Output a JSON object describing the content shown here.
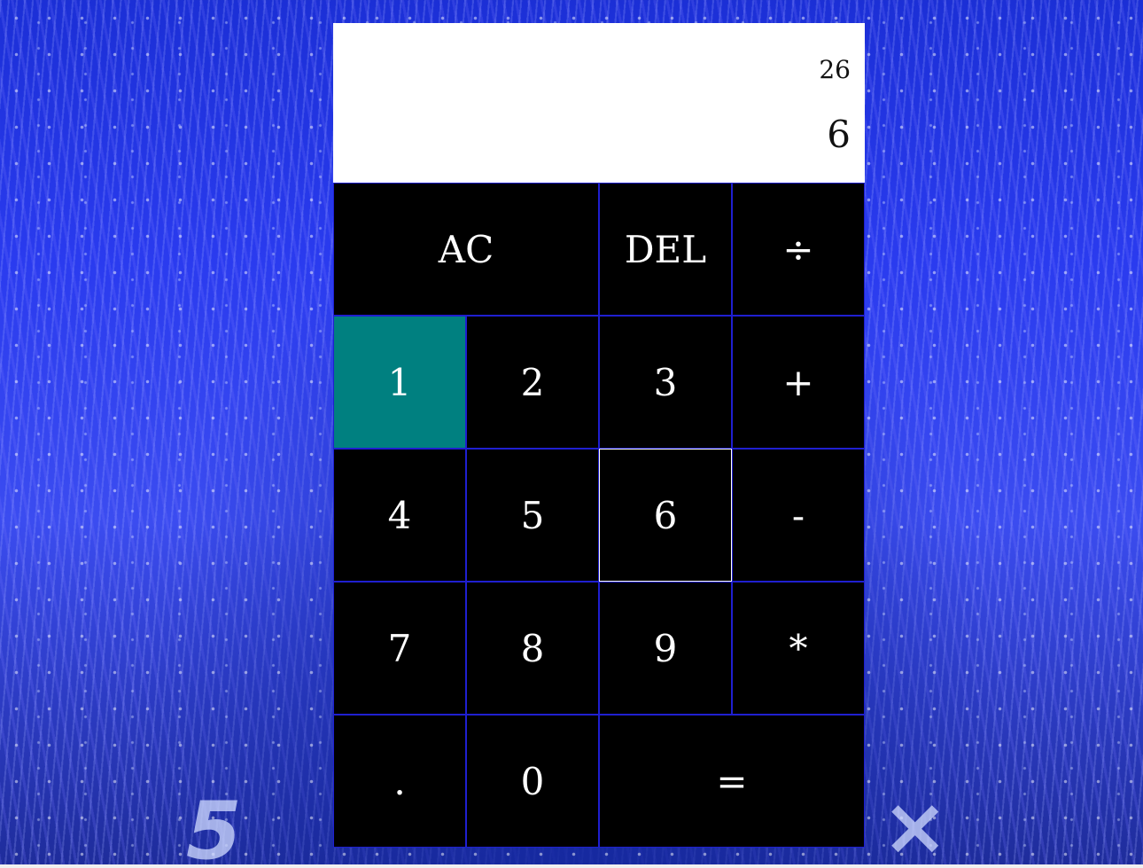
{
  "background": {
    "key_glyphs": [
      "5",
      "×"
    ]
  },
  "display": {
    "previous_operand": "26",
    "current_operand": "6"
  },
  "keys": {
    "ac": "AC",
    "del": "DEL",
    "divide": "÷",
    "one": "1",
    "two": "2",
    "three": "3",
    "plus": "+",
    "four": "4",
    "five": "5",
    "six": "6",
    "minus": "-",
    "seven": "7",
    "eight": "8",
    "nine": "9",
    "multiply": "*",
    "dot": ".",
    "zero": "0",
    "equals": "="
  },
  "colors": {
    "key_background": "#000000",
    "key_border": "#1f1fd0",
    "active_key": "#008080",
    "display_background": "#ffffff"
  }
}
